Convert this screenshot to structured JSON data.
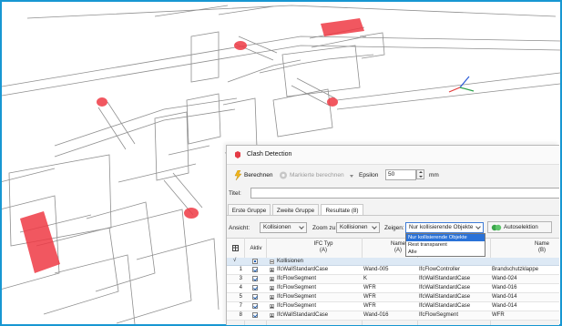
{
  "dialog": {
    "title": "Clash Detection",
    "toolbar": {
      "calc_label": "Berechnen",
      "calc_marked_label": "Markierte berechnen",
      "epsilon_label": "Epsilon",
      "epsilon_value": "50",
      "unit_label": "mm"
    },
    "title_field": {
      "label": "Titel:",
      "value": ""
    },
    "tabs": [
      {
        "label": "Erste Gruppe",
        "active": false
      },
      {
        "label": "Zweite Gruppe",
        "active": false
      },
      {
        "label": "Resultate (8)",
        "active": true
      }
    ],
    "options": {
      "view_label": "Ansicht:",
      "view_value": "Kollisionen",
      "zoom_label": "Zoom zu:",
      "zoom_value": "Kollisionen",
      "show_label": "Zeigen:",
      "show_value": "Nur kollisierende Objekte",
      "show_options": [
        "Nur kollisierende Objekte",
        "Rest transparent",
        "Alle"
      ],
      "auto_select_label": "Autoselektion"
    },
    "table": {
      "headers": {
        "active": "Aktiv",
        "ifc_type_a": "IFC Typ",
        "ifc_type_a_sub": "(A)",
        "name_a": "Name",
        "name_a_sub": "(A)",
        "name_b": "Name",
        "name_b_sub": "(B)"
      },
      "check_mark": "√",
      "group_label": "Kollisionen",
      "rows": [
        {
          "num": "1",
          "type_a": "IfcWallStandardCase",
          "name_a": "Wand-005",
          "type_b": "IfcFlowController",
          "name_b": "Brandschutzklappe"
        },
        {
          "num": "3",
          "type_a": "IfcFlowSegment",
          "name_a": "K",
          "type_b": "IfcWallStandardCase",
          "name_b": "Wand-024"
        },
        {
          "num": "4",
          "type_a": "IfcFlowSegment",
          "name_a": "WFR",
          "type_b": "IfcWallStandardCase",
          "name_b": "Wand-016"
        },
        {
          "num": "5",
          "type_a": "IfcFlowSegment",
          "name_a": "WFR",
          "type_b": "IfcWallStandardCase",
          "name_b": "Wand-014"
        },
        {
          "num": "7",
          "type_a": "IfcFlowSegment",
          "name_a": "WFR",
          "type_b": "IfcWallStandardCase",
          "name_b": "Wand-014"
        },
        {
          "num": "8",
          "type_a": "IfcWallStandardCase",
          "name_a": "Wand-016",
          "type_b": "IfcFlowSegment",
          "name_b": "WFR"
        }
      ]
    }
  },
  "colors": {
    "frame": "#1797d2",
    "collision": "#ee3a44",
    "selection": "#2a72d8",
    "group_row": "#dde9f5"
  }
}
